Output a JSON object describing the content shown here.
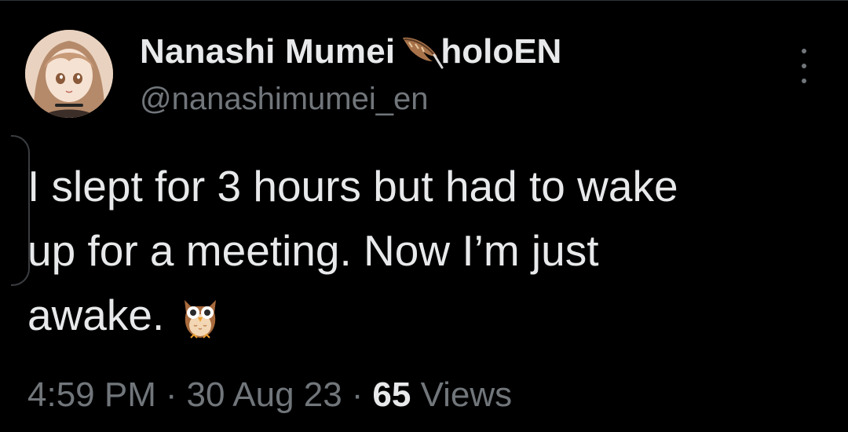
{
  "tweet": {
    "author": {
      "display_name": "Nanashi Mumei",
      "affiliation": "holoEN",
      "handle": "@nanashimumei_en",
      "avatar_icon": "avatar-image",
      "name_badge_icon": "feather-icon"
    },
    "text_line_1": "I slept for 3 hours but had to wake",
    "text_line_2": "up for a meeting. Now I’m just",
    "text_line_3": "awake.",
    "emoji_icon": "owl-emoji",
    "time": "4:59 PM",
    "separator_1": "·",
    "date": "30 Aug 23",
    "separator_2": "·",
    "views_count": "65",
    "views_label": "Views",
    "more_icon": "more-vertical-icon"
  },
  "colors": {
    "background": "#000000",
    "text_primary": "#e7e9ea",
    "text_secondary": "#71767b"
  }
}
